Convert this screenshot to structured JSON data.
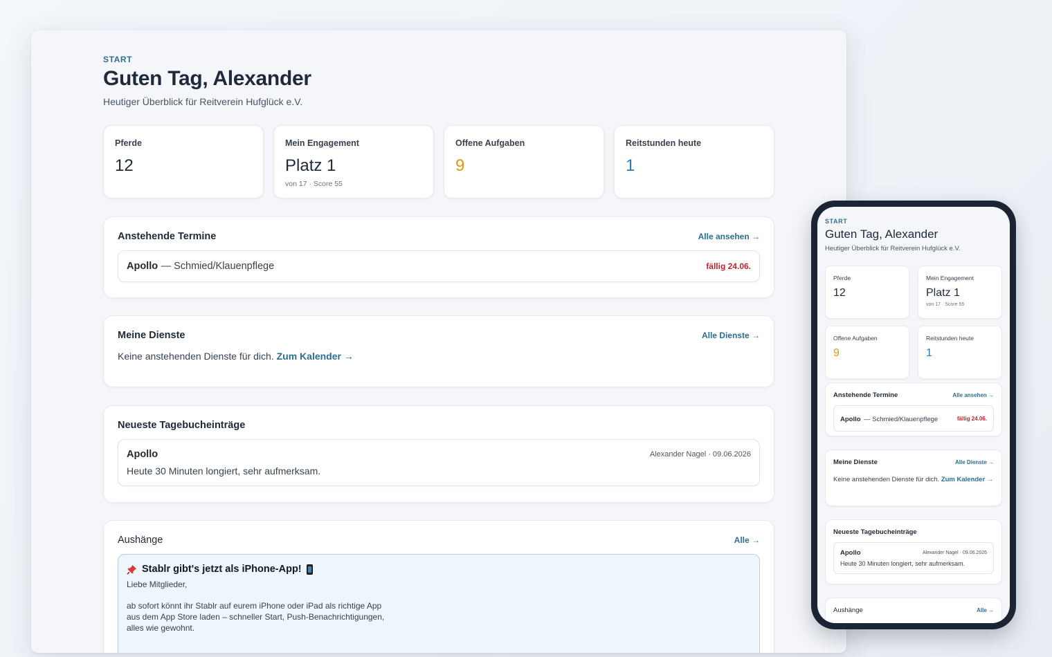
{
  "page": {
    "eyebrow": "START",
    "title": "Guten Tag, Alexander",
    "subtitle": "Heutiger Überblick für Reitverein Hufglück e.V."
  },
  "stats": {
    "horses": {
      "label": "Pferde",
      "value": "12"
    },
    "engagement": {
      "label": "Mein Engagement",
      "value": "Platz 1",
      "sub": "von 17 · Score 55"
    },
    "tasks": {
      "label": "Offene Aufgaben",
      "value": "9"
    },
    "lessons": {
      "label": "Reitstunden heute",
      "value": "1"
    }
  },
  "appointments": {
    "title": "Anstehende Termine",
    "link": "Alle ansehen →",
    "item": {
      "horse": "Apollo",
      "type": "— Schmied/Klauenpflege",
      "due": "fällig 24.06."
    }
  },
  "services": {
    "title": "Meine Dienste",
    "link": "Alle Dienste →",
    "empty_text": "Keine anstehenden Dienste für dich.",
    "calendar_link": "Zum Kalender →"
  },
  "diary": {
    "title": "Neueste Tagebucheinträge",
    "entry": {
      "horse": "Apollo",
      "meta": "Alexander Nagel · 09.06.2026",
      "text": "Heute 30 Minuten longiert, sehr aufmerksam."
    }
  },
  "notices": {
    "title": "Aushänge",
    "link": "Alle →",
    "item": {
      "title": "Stablr gibt's jetzt als iPhone-App!",
      "greeting": "Liebe Mitglieder,",
      "line1": "ab sofort könnt ihr Stablr auf eurem iPhone oder iPad als richtige App",
      "line2": "aus dem App Store laden – schneller Start, Push-Benachrichtigungen,",
      "line3": "alles wie gewohnt."
    }
  },
  "icons": {
    "pin": "pushpin-icon",
    "phone": "mobile-phone-icon"
  },
  "colors": {
    "accent": "#2a6e92",
    "orange": "#e0980e",
    "blue": "#2a78b5",
    "due": "#c0262d"
  }
}
